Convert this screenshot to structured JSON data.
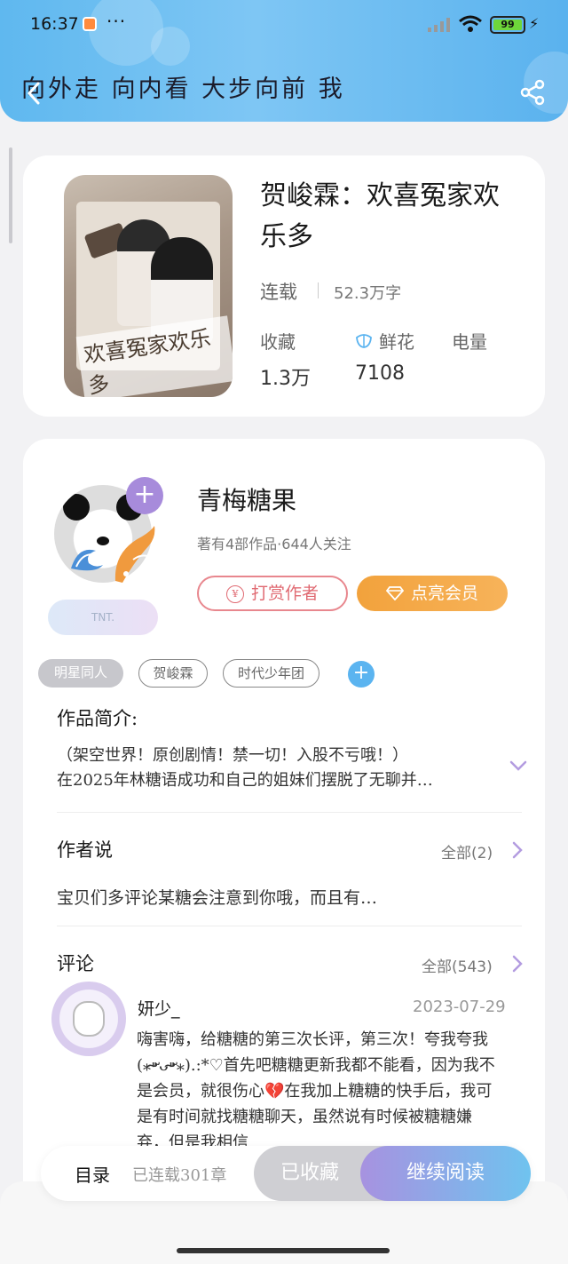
{
  "status_bar": {
    "time": "16:37",
    "battery": "99"
  },
  "header": {
    "marquee": "向外走 向内看 大步向前 我"
  },
  "book": {
    "title": "贺峻霖：欢喜冤家欢乐多",
    "cover_title": "欢喜冤家欢乐多",
    "status": "连载",
    "word_count": "52.3万字",
    "stats": [
      {
        "label": "收藏",
        "value": "1.3万"
      },
      {
        "label": "鲜花",
        "value": "7108"
      },
      {
        "label": "电量",
        "value": ""
      }
    ]
  },
  "author": {
    "name": "青梅糖果",
    "meta": "著有4部作品·644人关注",
    "badge": "TNT.",
    "follow_label": "+",
    "tip_label": "打赏作者",
    "tip_icon": "¥",
    "vip_label": "点亮会员"
  },
  "tags": [
    "明星同人",
    "贺峻霖",
    "时代少年团"
  ],
  "intro": {
    "title": "作品简介:",
    "lines": [
      "（架空世界！原创剧情！禁一切！入股不亏哦！）",
      "在2025年林糖语成功和自己的姐妹们摆脱了无聊并…"
    ]
  },
  "author_say": {
    "title": "作者说",
    "more": "全部(2)",
    "text": "宝贝们多评论某糖会注意到你哦，而且有…"
  },
  "comments": {
    "title": "评论",
    "more": "全部(543)",
    "items": [
      {
        "user": "妍少_",
        "date": "2023-07-29",
        "text_a": "嗨害嗨，给糖糖的第三次长评，第三次！夸我夸我(⁎⁍̴̛ᴗ⁍̴̛⁎).:*♡首先吧糖糖更新我都不能看，因为我不是会员，就很伤心",
        "emoji": "💔",
        "text_b": "在我加上糖糖的快手后，我可是有时间就找糖糖聊天，虽然说有时候被糖糖嫌弃，但是我相信"
      }
    ]
  },
  "bottom": {
    "toc": "目录",
    "chapters": "已连载301章",
    "collected": "已收藏",
    "read": "继续阅读"
  }
}
